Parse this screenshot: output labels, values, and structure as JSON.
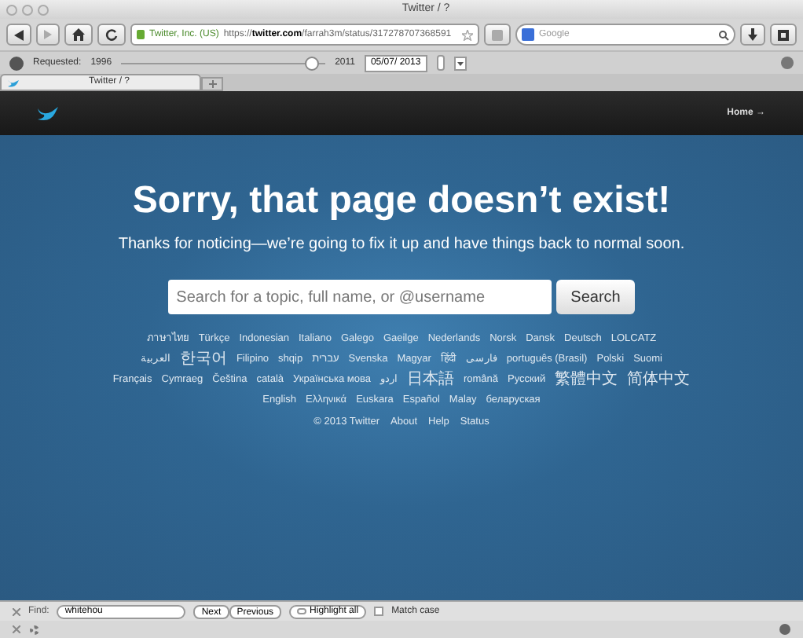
{
  "window": {
    "title": "Twitter / ?"
  },
  "toolbar": {
    "identity": "Twitter, Inc. (US)",
    "url_prefix": "https://",
    "url_host": "twitter.com",
    "url_path": "/farrah3m/status/317278707368591",
    "search_engine_placeholder": "Google"
  },
  "wayback": {
    "label": "Requested:",
    "start_year": "1996",
    "end_year": "2011",
    "level": 0.93,
    "date": "05/07/ 2013"
  },
  "tabs": [
    {
      "label": "Twitter / ?",
      "selected": true
    }
  ],
  "site_header": {
    "home_link": "Home →"
  },
  "error": {
    "title": "Sorry, that page doesn’t exist!",
    "message": "Thanks for noticing—we’re going to fix it up and have things back to normal soon.",
    "search_placeholder": "Search for a topic, full name, or @username",
    "search_button": "Search"
  },
  "languages": [
    [
      "ภาษาไทย",
      "Türkçe",
      "Indonesian",
      "Italiano",
      "Galego",
      "Gaeilge",
      "Nederlands",
      "Norsk",
      "Dansk",
      "Deutsch",
      "LOLCATZ"
    ],
    [
      "العربية",
      "한국어",
      "Filipino",
      "shqip",
      "עברית",
      "Svenska",
      "Magyar",
      "हिंदी",
      "فارسی",
      "português (Brasil)",
      "Polski",
      "Suomi"
    ],
    [
      "Français",
      "Cymraeg",
      "Čeština",
      "català",
      "Українська мова",
      "اردو",
      "日本語",
      "română",
      "Русский",
      "繁體中文",
      "简体中文"
    ],
    [
      "English",
      "Ελληνικά",
      "Euskara",
      "Español",
      "Malay",
      "беларуская"
    ]
  ],
  "footer": [
    "© 2013 Twitter",
    "About",
    "Help",
    "Status"
  ],
  "find_bar": {
    "label": "Find:",
    "value": "whitehou",
    "buttons": [
      "Next",
      "Previous"
    ],
    "highlight_all": {
      "label": "Highlight all",
      "checked": false
    },
    "match_case": {
      "label": "Match case",
      "checked": false
    }
  }
}
